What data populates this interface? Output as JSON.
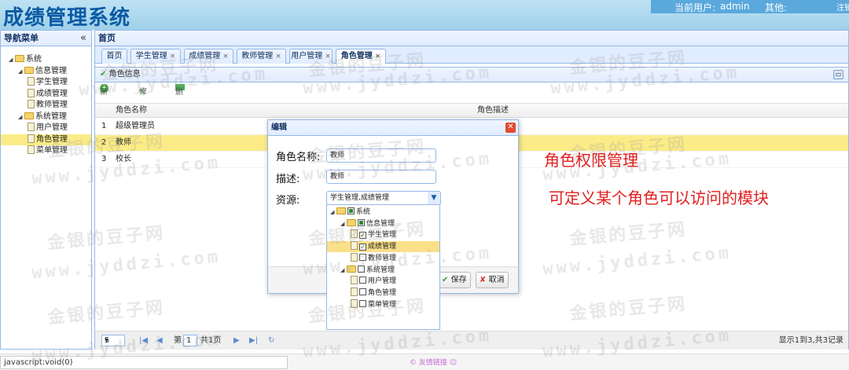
{
  "header": {
    "app_title": "成绩管理系统",
    "current_user_label": "当前用户:",
    "current_user": "admin",
    "other_label": "其他:",
    "logout_label": "注销"
  },
  "sidebar": {
    "title": "导航菜单",
    "collapse_icon": "«",
    "tree": [
      {
        "label": "系统",
        "level": 0,
        "kind": "folder"
      },
      {
        "label": "信息管理",
        "level": 1,
        "kind": "folder"
      },
      {
        "label": "学生管理",
        "level": 2,
        "kind": "file"
      },
      {
        "label": "成绩管理",
        "level": 2,
        "kind": "file"
      },
      {
        "label": "教师管理",
        "level": 2,
        "kind": "file"
      },
      {
        "label": "系统管理",
        "level": 1,
        "kind": "folder"
      },
      {
        "label": "用户管理",
        "level": 2,
        "kind": "file"
      },
      {
        "label": "角色管理",
        "level": 2,
        "kind": "file",
        "selected": true
      },
      {
        "label": "菜单管理",
        "level": 2,
        "kind": "file"
      }
    ]
  },
  "main": {
    "home_title": "首页",
    "tabs": [
      {
        "label": "首页",
        "closable": false
      },
      {
        "label": "学生管理",
        "closable": true
      },
      {
        "label": "成绩管理",
        "closable": true
      },
      {
        "label": "教师管理",
        "closable": true
      },
      {
        "label": "用户管理",
        "closable": true
      },
      {
        "label": "角色管理",
        "closable": true,
        "active": true
      }
    ],
    "panel_title": "角色信息",
    "toolbar": {
      "add": "新增",
      "edit": "修改",
      "delete": "删除"
    },
    "grid": {
      "columns": [
        "角色名称",
        "角色描述"
      ],
      "rows": [
        {
          "num": "1",
          "name": "超级管理员",
          "desc": ""
        },
        {
          "num": "2",
          "name": "教师",
          "desc": "",
          "selected": true
        },
        {
          "num": "3",
          "name": "校长",
          "desc": ""
        }
      ]
    },
    "pager": {
      "page_size": "5",
      "page_prefix": "第",
      "page_number": "1",
      "page_suffix": "共1页",
      "summary": "显示1到3,共3记录"
    }
  },
  "dialog": {
    "title": "编辑",
    "role_name_label": "角色名称:",
    "role_name_value": "教师",
    "desc_label": "描述:",
    "desc_value": "教师",
    "resource_label": "资源:",
    "resource_value": "学生管理,成绩管理",
    "save_label": "保存",
    "cancel_label": "取消",
    "resource_tree": [
      {
        "label": "系统",
        "level": 0,
        "kind": "folder",
        "check": "partial"
      },
      {
        "label": "信息管理",
        "level": 1,
        "kind": "folder",
        "check": "partial"
      },
      {
        "label": "学生管理",
        "level": 2,
        "kind": "file",
        "check": "checked"
      },
      {
        "label": "成绩管理",
        "level": 2,
        "kind": "file",
        "check": "checked",
        "selected": true
      },
      {
        "label": "教师管理",
        "level": 2,
        "kind": "file",
        "check": "none"
      },
      {
        "label": "系统管理",
        "level": 1,
        "kind": "folder",
        "check": "none"
      },
      {
        "label": "用户管理",
        "level": 2,
        "kind": "file",
        "check": "none"
      },
      {
        "label": "角色管理",
        "level": 2,
        "kind": "file",
        "check": "none"
      },
      {
        "label": "菜单管理",
        "level": 2,
        "kind": "file",
        "check": "none"
      }
    ]
  },
  "annotation": {
    "line1": "角色权限管理",
    "line2": "可定义某个角色可以访问的模块"
  },
  "watermark": {
    "cn": "金银的豆子网",
    "en": "www.jyddzi.com"
  },
  "statusbar": {
    "url": "javascript:void(0)",
    "friend_link": "友情链接"
  }
}
